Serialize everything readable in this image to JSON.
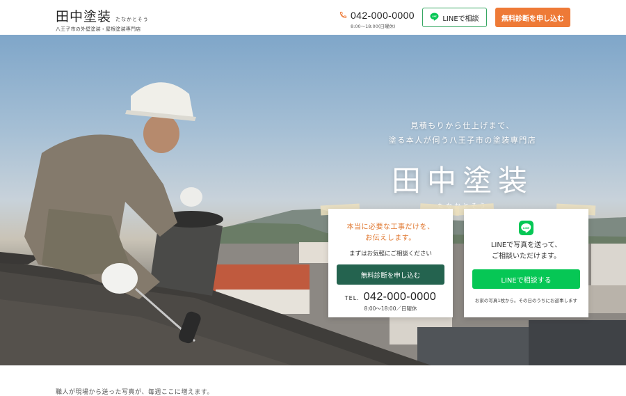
{
  "header": {
    "brand_name": "田中塗装",
    "brand_kana": "たなかとそう",
    "brand_tagline": "八王子市の外壁塗装・屋根塗装専門店",
    "tel": "042-000-0000",
    "hours": "8:00〜18:00(日曜休)",
    "line_button": "LINEで相談",
    "diagnosis_button": "無料診断を申し込む"
  },
  "hero": {
    "catch_line1": "見積もりから仕上げまで、",
    "catch_line2": "塗る本人が伺う八王子市の塗装専門店",
    "title": "田中塗装",
    "title_kana": "たなかとそう"
  },
  "card_diagnosis": {
    "lead_line1": "本当に必要な工事だけを、",
    "lead_line2": "お伝えします。",
    "sub": "まずはお気軽にご相談ください",
    "button": "無料診断を申し込む",
    "tel_label": "TEL.",
    "tel": "042-000-0000",
    "hours": "8:00〜18:00／日曜休"
  },
  "card_line": {
    "icon_text": "LINE",
    "lead_line1": "LINEで写真を送って、",
    "lead_line2": "ご相談いただけます。",
    "button": "LINEで相談する",
    "note": "お家の写真1枚から。その日のうちにお返事します"
  },
  "below": {
    "peek_text": "職人が現場から送った写真が、毎週ここに増えます。"
  },
  "colors": {
    "accent_orange": "#ee7a37",
    "deep_green": "#24634f",
    "line_green": "#06c755"
  }
}
